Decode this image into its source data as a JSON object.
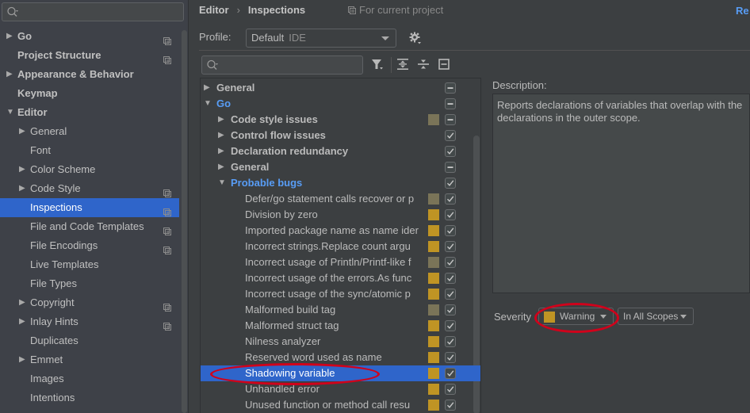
{
  "sidebar": {
    "search_placeholder": "",
    "items": [
      {
        "label": "Go",
        "level": 0,
        "arrow": "right",
        "bold": true,
        "project_icon": true,
        "selected": false
      },
      {
        "label": "Project Structure",
        "level": 0,
        "arrow": "",
        "bold": true,
        "project_icon": true,
        "selected": false
      },
      {
        "label": "Appearance & Behavior",
        "level": 0,
        "arrow": "right",
        "bold": true,
        "project_icon": false,
        "selected": false
      },
      {
        "label": "Keymap",
        "level": 0,
        "arrow": "",
        "bold": true,
        "project_icon": false,
        "selected": false
      },
      {
        "label": "Editor",
        "level": 0,
        "arrow": "down",
        "bold": true,
        "project_icon": false,
        "selected": false
      },
      {
        "label": "General",
        "level": 1,
        "arrow": "right",
        "bold": false,
        "project_icon": false,
        "selected": false
      },
      {
        "label": "Font",
        "level": 1,
        "arrow": "",
        "bold": false,
        "project_icon": false,
        "selected": false
      },
      {
        "label": "Color Scheme",
        "level": 1,
        "arrow": "right",
        "bold": false,
        "project_icon": false,
        "selected": false
      },
      {
        "label": "Code Style",
        "level": 1,
        "arrow": "right",
        "bold": false,
        "project_icon": true,
        "selected": false
      },
      {
        "label": "Inspections",
        "level": 1,
        "arrow": "",
        "bold": false,
        "project_icon": true,
        "selected": true
      },
      {
        "label": "File and Code Templates",
        "level": 1,
        "arrow": "",
        "bold": false,
        "project_icon": true,
        "selected": false
      },
      {
        "label": "File Encodings",
        "level": 1,
        "arrow": "",
        "bold": false,
        "project_icon": true,
        "selected": false
      },
      {
        "label": "Live Templates",
        "level": 1,
        "arrow": "",
        "bold": false,
        "project_icon": false,
        "selected": false
      },
      {
        "label": "File Types",
        "level": 1,
        "arrow": "",
        "bold": false,
        "project_icon": false,
        "selected": false
      },
      {
        "label": "Copyright",
        "level": 1,
        "arrow": "right",
        "bold": false,
        "project_icon": true,
        "selected": false
      },
      {
        "label": "Inlay Hints",
        "level": 1,
        "arrow": "right",
        "bold": false,
        "project_icon": true,
        "selected": false
      },
      {
        "label": "Duplicates",
        "level": 1,
        "arrow": "",
        "bold": false,
        "project_icon": false,
        "selected": false
      },
      {
        "label": "Emmet",
        "level": 1,
        "arrow": "right",
        "bold": false,
        "project_icon": false,
        "selected": false
      },
      {
        "label": "Images",
        "level": 1,
        "arrow": "",
        "bold": false,
        "project_icon": false,
        "selected": false
      },
      {
        "label": "Intentions",
        "level": 1,
        "arrow": "",
        "bold": false,
        "project_icon": false,
        "selected": false
      }
    ]
  },
  "header": {
    "breadcrumb": [
      "Editor",
      "Inspections"
    ],
    "breadcrumb_separator": "›",
    "scope_note": "For current project",
    "reset_link": "Re"
  },
  "profile": {
    "label": "Profile:",
    "value": "Default",
    "qualifier": "IDE"
  },
  "toolbar": {
    "filter_placeholder": "",
    "icons": [
      "filter-icon",
      "expand-all-icon",
      "collapse-all-icon",
      "reset-icon"
    ]
  },
  "inspections": {
    "rows": [
      {
        "label": "General",
        "level": 0,
        "arrow": "right",
        "category": true,
        "blue": false,
        "severity": "",
        "check": "partial",
        "selected": false
      },
      {
        "label": "Go",
        "level": 0,
        "arrow": "down",
        "category": true,
        "blue": true,
        "severity": "",
        "check": "partial",
        "selected": false
      },
      {
        "label": "Code style issues",
        "level": 1,
        "arrow": "right",
        "category": true,
        "blue": false,
        "severity": "weak",
        "check": "partial",
        "selected": false
      },
      {
        "label": "Control flow issues",
        "level": 1,
        "arrow": "right",
        "category": true,
        "blue": false,
        "severity": "",
        "check": "checked",
        "selected": false
      },
      {
        "label": "Declaration redundancy",
        "level": 1,
        "arrow": "right",
        "category": true,
        "blue": false,
        "severity": "",
        "check": "checked",
        "selected": false
      },
      {
        "label": "General",
        "level": 1,
        "arrow": "right",
        "category": true,
        "blue": false,
        "severity": "",
        "check": "partial",
        "selected": false
      },
      {
        "label": "Probable bugs",
        "level": 1,
        "arrow": "down",
        "category": true,
        "blue": true,
        "severity": "",
        "check": "checked",
        "selected": false
      },
      {
        "label": "Defer/go statement calls recover or p",
        "level": 2,
        "arrow": "",
        "category": false,
        "blue": false,
        "severity": "weak",
        "check": "checked",
        "selected": false
      },
      {
        "label": "Division by zero",
        "level": 2,
        "arrow": "",
        "category": false,
        "blue": false,
        "severity": "warning",
        "check": "checked",
        "selected": false
      },
      {
        "label": "Imported package name as name ider",
        "level": 2,
        "arrow": "",
        "category": false,
        "blue": false,
        "severity": "warning",
        "check": "checked",
        "selected": false
      },
      {
        "label": "Incorrect strings.Replace count argu",
        "level": 2,
        "arrow": "",
        "category": false,
        "blue": false,
        "severity": "warning",
        "check": "checked",
        "selected": false
      },
      {
        "label": "Incorrect usage of Println/Printf-like f",
        "level": 2,
        "arrow": "",
        "category": false,
        "blue": false,
        "severity": "weak",
        "check": "checked",
        "selected": false
      },
      {
        "label": "Incorrect usage of the errors.As func",
        "level": 2,
        "arrow": "",
        "category": false,
        "blue": false,
        "severity": "warning",
        "check": "checked",
        "selected": false
      },
      {
        "label": "Incorrect usage of the sync/atomic p",
        "level": 2,
        "arrow": "",
        "category": false,
        "blue": false,
        "severity": "warning",
        "check": "checked",
        "selected": false
      },
      {
        "label": "Malformed build tag",
        "level": 2,
        "arrow": "",
        "category": false,
        "blue": false,
        "severity": "weak",
        "check": "checked",
        "selected": false
      },
      {
        "label": "Malformed struct tag",
        "level": 2,
        "arrow": "",
        "category": false,
        "blue": false,
        "severity": "warning",
        "check": "checked",
        "selected": false
      },
      {
        "label": "Nilness analyzer",
        "level": 2,
        "arrow": "",
        "category": false,
        "blue": false,
        "severity": "warning",
        "check": "checked",
        "selected": false
      },
      {
        "label": "Reserved word used as name",
        "level": 2,
        "arrow": "",
        "category": false,
        "blue": false,
        "severity": "warning",
        "check": "checked",
        "selected": false
      },
      {
        "label": "Shadowing variable",
        "level": 2,
        "arrow": "",
        "category": false,
        "blue": false,
        "severity": "warning",
        "check": "checked",
        "selected": true
      },
      {
        "label": "Unhandled error",
        "level": 2,
        "arrow": "",
        "category": false,
        "blue": false,
        "severity": "warning",
        "check": "checked",
        "selected": false
      },
      {
        "label": "Unused function or method call resu",
        "level": 2,
        "arrow": "",
        "category": false,
        "blue": false,
        "severity": "warning",
        "check": "checked",
        "selected": false
      }
    ]
  },
  "description": {
    "label": "Description:",
    "text": "Reports declarations of variables that overlap with the declarations in the outer scope."
  },
  "severity": {
    "label": "Severity",
    "value": "Warning",
    "scope": "In All Scopes"
  },
  "colors": {
    "selection": "#2f65ca",
    "link_blue": "#589df6",
    "warning": "#bf9424",
    "weak_warning": "#7a7458",
    "annotation_red": "#d0021b"
  }
}
